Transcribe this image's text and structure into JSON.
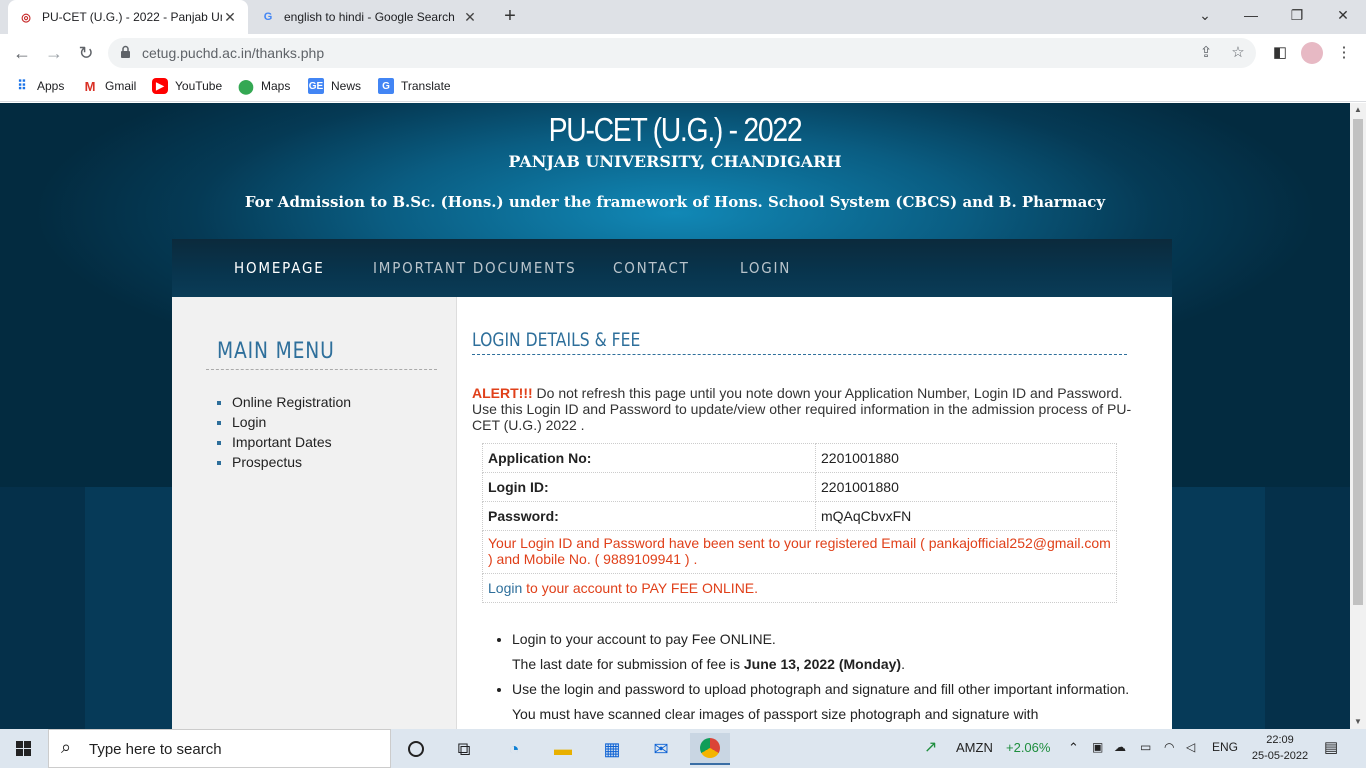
{
  "browser": {
    "tabs": [
      {
        "title": "PU-CET (U.G.) - 2022 - Panjab Un",
        "active": true
      },
      {
        "title": "english to hindi - Google Search",
        "active": false
      }
    ],
    "url": "cetug.puchd.ac.in/thanks.php",
    "bookmarks": [
      "Apps",
      "Gmail",
      "YouTube",
      "Maps",
      "News",
      "Translate"
    ]
  },
  "site": {
    "title": "PU-CET (U.G.) - 2022",
    "university": "PANJAB UNIVERSITY, CHANDIGARH",
    "tagline": "For Admission to B.Sc. (Hons.) under the framework of Hons. School System (CBCS) and B. Pharmacy",
    "menu": [
      "HOMEPAGE",
      "IMPORTANT DOCUMENTS",
      "CONTACT",
      "LOGIN"
    ]
  },
  "sidebar": {
    "title": "MAIN MENU",
    "items": [
      "Online Registration",
      "Login",
      "Important Dates",
      "Prospectus"
    ]
  },
  "main": {
    "title": "LOGIN DETAILS & FEE",
    "alert_label": "ALERT!!!",
    "alert_text": " Do not refresh this page until you note down your Application Number, Login ID and Password. Use this Login ID and Password to update/view other required information in the admission process of PU-CET (U.G.) 2022 .",
    "details": [
      {
        "label": "Application No:",
        "value": "2201001880"
      },
      {
        "label": "Login ID:",
        "value": "2201001880"
      },
      {
        "label": "Password:",
        "value": "mQAqCbvxFN"
      }
    ],
    "sent_message": "Your Login ID and Password have been sent to your registered Email ( pankajofficial252@gmail.com ) and Mobile No. ( 9889109941 ) .",
    "login_link": "Login",
    "login_suffix": " to your account to PAY FEE ONLINE.",
    "note1": "Login to your account to pay Fee ONLINE.",
    "note1b_prefix": "The last date for submission of fee is ",
    "note1b_bold": "June 13, 2022 (Monday)",
    "note1b_suffix": ".",
    "note2": "Use the login and password to upload photograph and signature and fill other important information. You must have scanned clear images of passport size photograph and signature with"
  },
  "taskbar": {
    "search_placeholder": "Type here to search",
    "stock_symbol": "AMZN",
    "stock_change": "+2.06%",
    "language": "ENG",
    "time": "22:09",
    "date": "25-05-2022"
  }
}
